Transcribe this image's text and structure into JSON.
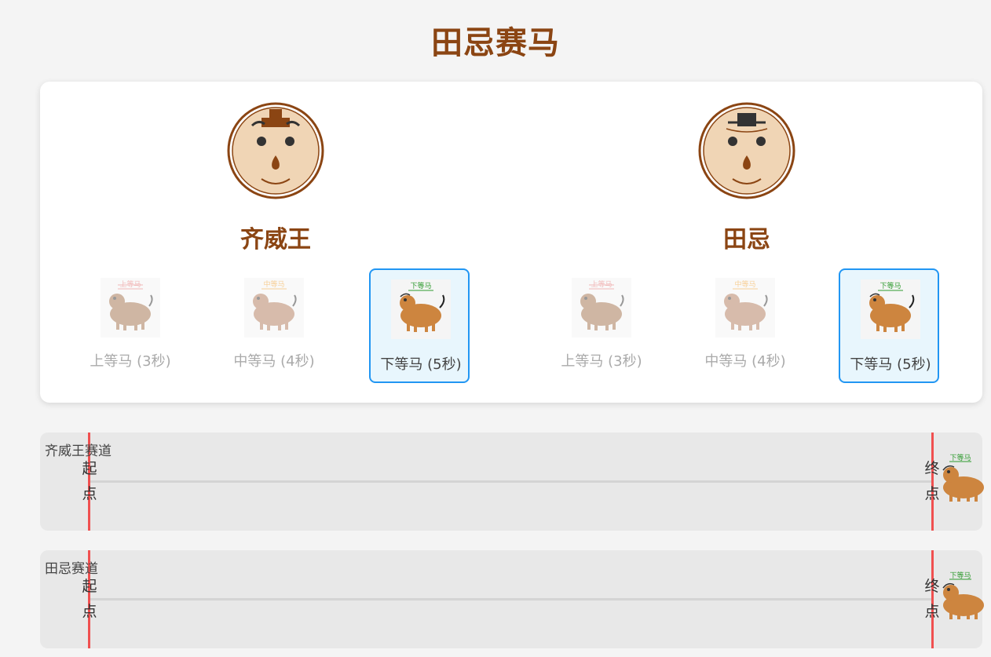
{
  "title": "田忌赛马",
  "players": [
    {
      "name": "齐威王",
      "horses": [
        {
          "tag": "上等马",
          "label": "上等马 (3秒)",
          "state": "dim"
        },
        {
          "tag": "中等马",
          "label": "中等马 (4秒)",
          "state": "dim"
        },
        {
          "tag": "下等马",
          "label": "下等马 (5秒)",
          "state": "selected"
        }
      ]
    },
    {
      "name": "田忌",
      "horses": [
        {
          "tag": "上等马",
          "label": "上等马 (3秒)",
          "state": "dim"
        },
        {
          "tag": "中等马",
          "label": "中等马 (4秒)",
          "state": "dim"
        },
        {
          "tag": "下等马",
          "label": "下等马 (5秒)",
          "state": "selected"
        }
      ]
    }
  ],
  "tracks": [
    {
      "label": "齐威王赛道",
      "start": "起点",
      "finish": "终点",
      "runner_tag": "下等马",
      "progress": 1.0
    },
    {
      "label": "田忌赛道",
      "start": "起点",
      "finish": "终点",
      "runner_tag": "下等马",
      "progress": 1.0
    }
  ],
  "colors": {
    "title": "#8b4513",
    "selected_border": "#2196f3",
    "tag_top": "#e57373",
    "tag_mid": "#f0a030",
    "tag_low": "#2e9a2e",
    "horse_top": "#b0805a",
    "horse_mid": "#c09070",
    "horse_low": "#cd853f",
    "line": "#f05050"
  }
}
